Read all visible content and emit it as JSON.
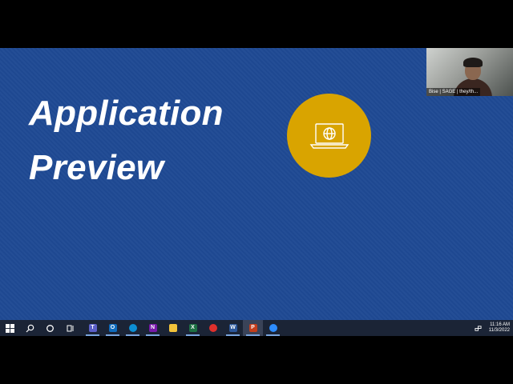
{
  "slide": {
    "title": "Application\nPreview"
  },
  "webcam": {
    "label": "Bise | SAGE | they/th..."
  },
  "taskbar": {
    "apps": [
      {
        "name": "teams-icon",
        "glyph": "T",
        "color": "#5b5fc7",
        "active": true
      },
      {
        "name": "outlook-icon",
        "glyph": "O",
        "color": "#0f6cbd",
        "active": true
      },
      {
        "name": "edge-icon",
        "glyph": "",
        "color": "#0c8fd4",
        "active": true
      },
      {
        "name": "onenote-icon",
        "glyph": "N",
        "color": "#7719aa",
        "active": true
      },
      {
        "name": "file-explorer-icon",
        "glyph": "",
        "color": "#f3c33a",
        "active": false
      },
      {
        "name": "excel-icon",
        "glyph": "X",
        "color": "#1d7044",
        "active": true
      },
      {
        "name": "record-icon",
        "glyph": "",
        "color": "#e0302c",
        "active": false
      },
      {
        "name": "word-icon",
        "glyph": "W",
        "color": "#2b579a",
        "active": true
      },
      {
        "name": "powerpoint-icon",
        "glyph": "P",
        "color": "#c43e1c",
        "active": true,
        "current": true
      },
      {
        "name": "zoom-icon",
        "glyph": "",
        "color": "#2d8cff",
        "active": true
      }
    ],
    "clock_time": "11:16 AM",
    "clock_date": "11/3/2022"
  },
  "colors": {
    "slide_background": "#1f4a94",
    "accent_circle": "#d9a400",
    "taskbar": "#1b2436"
  }
}
